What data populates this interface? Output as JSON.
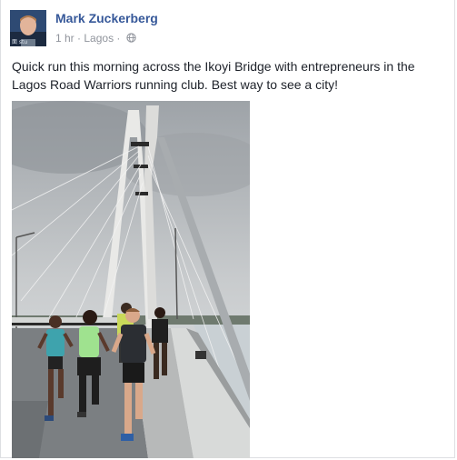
{
  "post": {
    "author": "Mark Zuckerberg",
    "time": "1 hr",
    "separator": "·",
    "location": "Lagos",
    "privacy_icon": "globe-icon",
    "text": "Quick run this morning across the Ikoyi Bridge with entrepreneurs in the Lagos Road Warriors running club. Best way to see a city!"
  },
  "colors": {
    "author_link": "#365899",
    "meta_text": "#90949c",
    "body_text": "#1d2129",
    "border": "#dddfe2"
  }
}
